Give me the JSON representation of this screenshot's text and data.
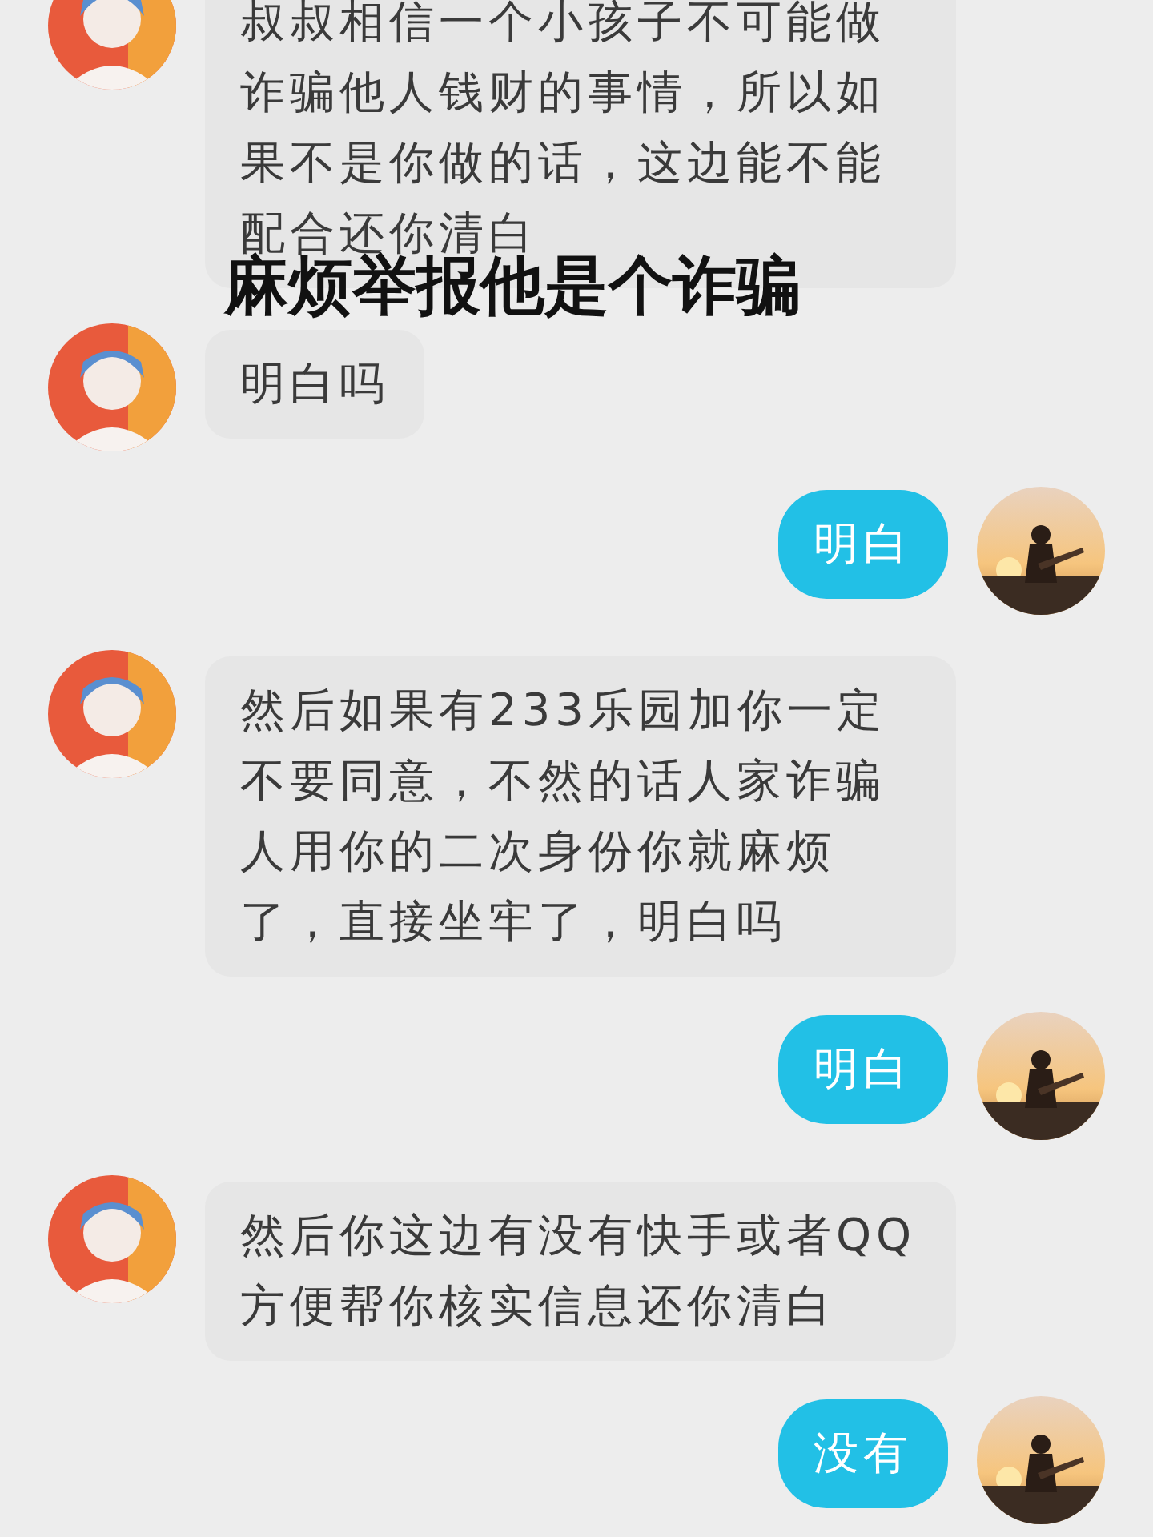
{
  "messages": [
    {
      "kind": "incoming",
      "text": "叔叔相信一个小孩子不可能做诈骗他人钱财的事情，所以如果不是你做的话，这边能不能配合还你清白"
    },
    {
      "kind": "caption",
      "text": "麻烦举报他是个诈骗"
    },
    {
      "kind": "incoming",
      "text": "明白吗"
    },
    {
      "kind": "outgoing",
      "text": "明白"
    },
    {
      "kind": "incoming",
      "text": "然后如果有233乐园加你一定不要同意，不然的话人家诈骗人用你的二次身份你就麻烦了，直接坐牢了，明白吗"
    },
    {
      "kind": "outgoing",
      "text": "明白"
    },
    {
      "kind": "incoming",
      "text": "然后你这边有没有快手或者QQ方便帮你核实信息还你清白"
    },
    {
      "kind": "outgoing",
      "text": "没有"
    }
  ]
}
